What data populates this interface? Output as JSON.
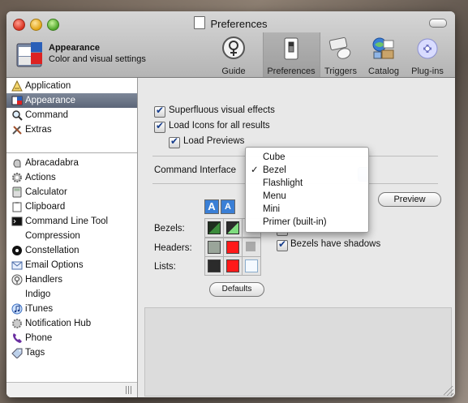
{
  "window": {
    "title": "Preferences"
  },
  "header": {
    "app_name": "Appearance",
    "app_subtitle": "Color and visual settings"
  },
  "toolbar": {
    "items": [
      {
        "label": "Guide",
        "icon": "guide-icon"
      },
      {
        "label": "Preferences",
        "icon": "switch-icon",
        "selected": true
      },
      {
        "label": "Triggers",
        "icon": "keyboard-mouse-icon"
      },
      {
        "label": "Catalog",
        "icon": "catalog-icon"
      },
      {
        "label": "Plug-ins",
        "icon": "plugin-icon"
      }
    ]
  },
  "sidebar": {
    "items": [
      {
        "label": "Application",
        "icon": "application-icon"
      },
      {
        "label": "Appearance",
        "icon": "appearance-icon",
        "selected": true
      },
      {
        "label": "Command",
        "icon": "magnifier-icon"
      },
      {
        "label": "Extras",
        "icon": "tools-icon"
      },
      {
        "label": "Abracadabra",
        "icon": "hand-icon"
      },
      {
        "label": "Actions",
        "icon": "gear-icon"
      },
      {
        "label": "Calculator",
        "icon": "calculator-icon"
      },
      {
        "label": "Clipboard",
        "icon": "clipboard-icon"
      },
      {
        "label": "Command Line Tool",
        "icon": "terminal-icon"
      },
      {
        "label": "Compression",
        "icon": ""
      },
      {
        "label": "Constellation",
        "icon": "constellation-icon"
      },
      {
        "label": "Email Options",
        "icon": "mail-icon"
      },
      {
        "label": "Handlers",
        "icon": "handlers-icon"
      },
      {
        "label": "Indigo",
        "icon": ""
      },
      {
        "label": "iTunes",
        "icon": "itunes-icon"
      },
      {
        "label": "Notification Hub",
        "icon": "notification-icon"
      },
      {
        "label": "Phone",
        "icon": "phone-icon"
      },
      {
        "label": "Tags",
        "icon": "tag-icon"
      }
    ]
  },
  "content": {
    "checkboxes": [
      {
        "label": "Superfluous visual effects",
        "checked": true
      },
      {
        "label": "Load Icons for all results",
        "checked": true
      },
      {
        "label": "Load Previews",
        "checked": true
      }
    ],
    "interface_label": "Command Interface",
    "preview_button": "Preview",
    "color_rows": [
      "Bezels:",
      "Headers:",
      "Lists:"
    ],
    "shadow_checkbox": {
      "label": "Bezels have shadows",
      "checked": true
    },
    "defaults_button": "Defaults"
  },
  "interface_menu": {
    "selected": "Bezel",
    "options": [
      "Cube",
      "Bezel",
      "Flashlight",
      "Menu",
      "Mini",
      "Primer (built-in)"
    ],
    "check_glyph": "✓"
  },
  "colors": {
    "selection": "#5c6678",
    "accent_blue": "#2b64c8",
    "swatch_dark": "#2b2b2b",
    "swatch_red": "#ff1a1a",
    "swatch_green": "#3db83d",
    "swatch_grey": "#9aa59a"
  }
}
